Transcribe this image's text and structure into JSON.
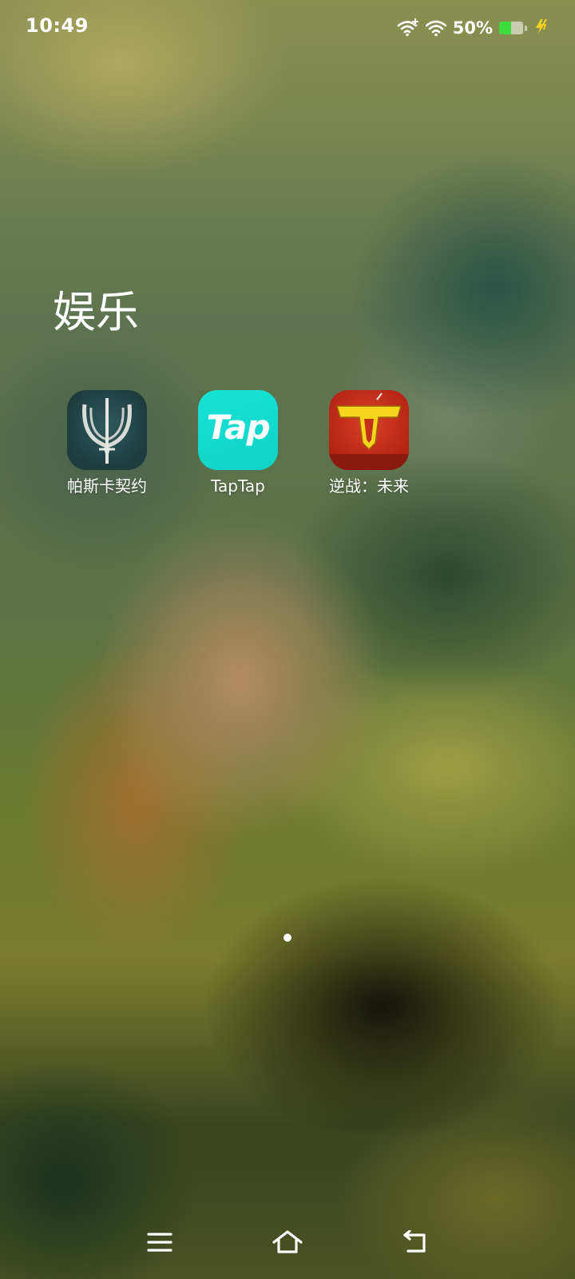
{
  "status_bar": {
    "time": "10:49",
    "battery_percent": "50%",
    "battery_level": 0.5,
    "icons": [
      "wifi-plus-icon",
      "wifi-icon",
      "battery-icon",
      "charging-icon"
    ]
  },
  "folder": {
    "title": "娱乐",
    "apps": [
      {
        "label": "帕斯卡契约",
        "icon": "pascal-contract-app-icon"
      },
      {
        "label": "TapTap",
        "icon": "taptap-app-icon",
        "icon_text": "Tap"
      },
      {
        "label": "逆战：未来",
        "icon": "nizhan-future-app-icon"
      }
    ]
  },
  "page_indicator": {
    "pages": 1,
    "current": 1
  },
  "nav_bar": {
    "buttons": [
      "menu-icon",
      "home-icon",
      "back-icon"
    ]
  },
  "colors": {
    "battery_fill": "#3ddc3d",
    "charging_bolt": "#f5d020",
    "taptap_brand": "#15dccf"
  }
}
